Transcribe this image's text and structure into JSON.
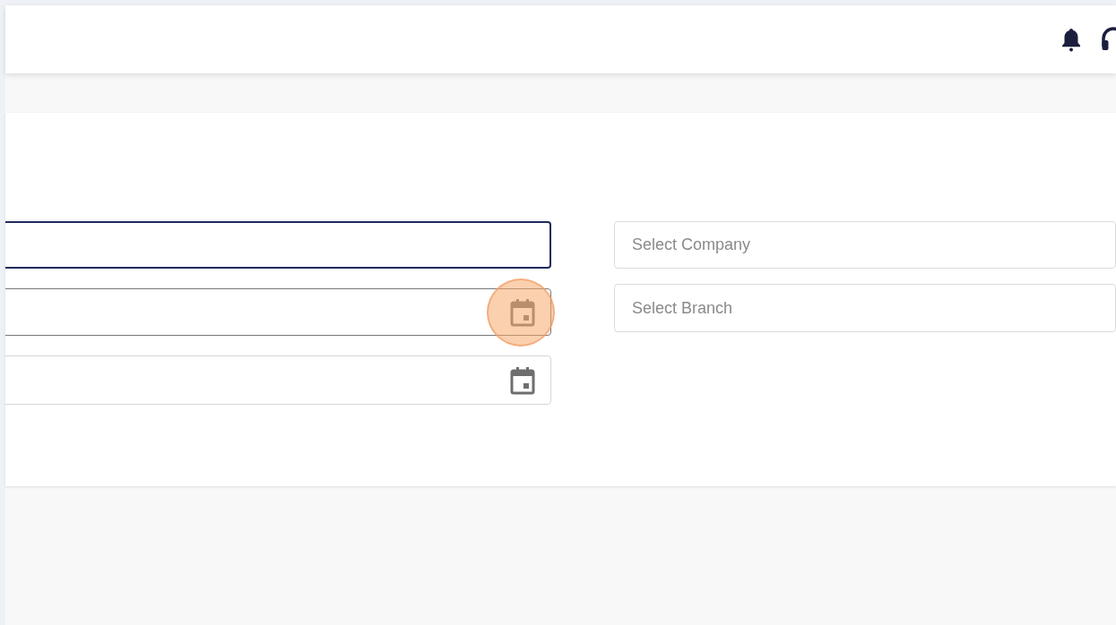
{
  "form": {
    "left_fields": [
      {
        "kind": "text",
        "focused": true
      },
      {
        "kind": "date",
        "focused": false,
        "highlighted": true
      },
      {
        "kind": "date",
        "focused": false,
        "highlighted": false
      }
    ],
    "right_fields": [
      {
        "placeholder": "Select Company"
      },
      {
        "placeholder": "Select Branch"
      }
    ]
  }
}
